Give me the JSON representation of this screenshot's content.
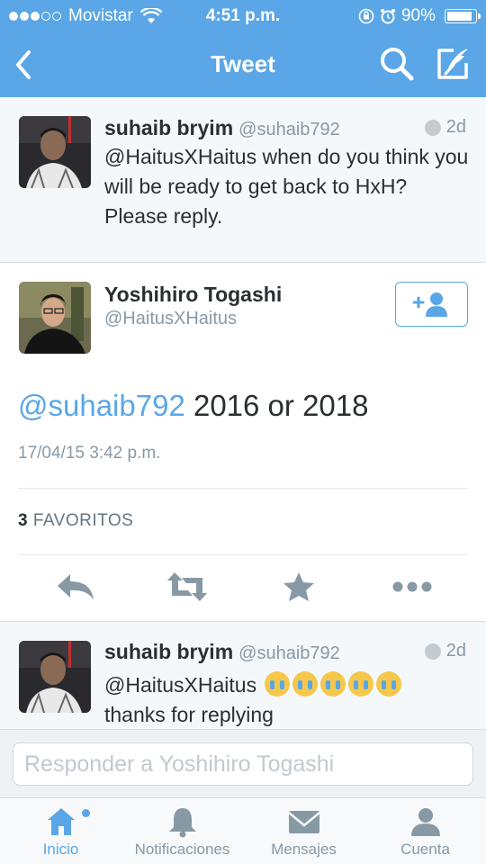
{
  "status_bar": {
    "carrier": "Movistar",
    "time": "4:51 p.m.",
    "battery": "90%",
    "battery_level": 0.9
  },
  "nav": {
    "title": "Tweet",
    "icons": [
      "back-chevron-icon",
      "search-icon",
      "compose-icon"
    ]
  },
  "previous_tweet": {
    "name": "suhaib bryim",
    "handle": "@suhaib792",
    "age": "2d",
    "text": "@HaitusXHaitus when do you think you will be ready to get back to HxH? Please reply."
  },
  "main_tweet": {
    "name": "Yoshihiro Togashi",
    "handle": "@HaitusXHaitus",
    "follow_icon": "add-user-icon",
    "mention": "@suhaib792",
    "text": " 2016 or 2018",
    "timestamp": "17/04/15 3:42 p.m.",
    "fav_count": "3",
    "fav_label": "FAVORITOS",
    "actions": [
      "reply-icon",
      "retweet-icon",
      "favorite-star-icon",
      "more-icon"
    ]
  },
  "next_tweet": {
    "name": "suhaib bryim",
    "handle": "@suhaib792",
    "age": "2d",
    "text_start": "@HaitusXHaitus",
    "emoji_count": 5,
    "text_end": "thanks for replying"
  },
  "reply": {
    "placeholder": "Responder a Yoshihiro Togashi"
  },
  "tabs": [
    {
      "label": "Inicio",
      "icon": "home-icon",
      "active": true
    },
    {
      "label": "Notificaciones",
      "icon": "bell-icon",
      "active": false
    },
    {
      "label": "Mensajes",
      "icon": "envelope-icon",
      "active": false
    },
    {
      "label": "Cuenta",
      "icon": "person-icon",
      "active": false
    }
  ],
  "colors": {
    "brand": "#5aa6e6",
    "text": "#292f33",
    "muted": "#8899a6"
  }
}
